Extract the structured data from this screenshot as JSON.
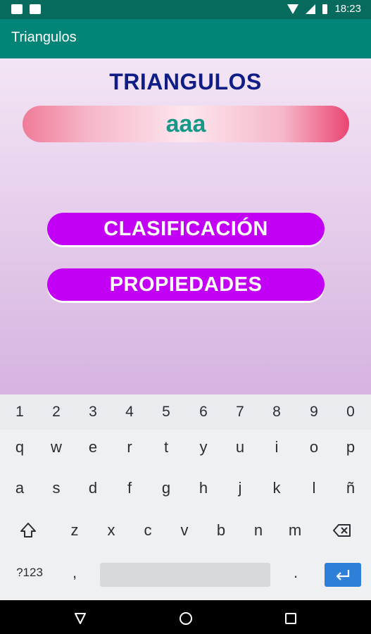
{
  "status_bar": {
    "time": "18:23"
  },
  "app_bar": {
    "title": "Triangulos"
  },
  "main": {
    "heading": "TRIANGULOS",
    "name_value": "aaa",
    "buttons": [
      {
        "label": "CLASIFICACIÓN"
      },
      {
        "label": "PROPIEDADES"
      }
    ]
  },
  "keyboard": {
    "number_row": [
      "1",
      "2",
      "3",
      "4",
      "5",
      "6",
      "7",
      "8",
      "9",
      "0"
    ],
    "row1": [
      "q",
      "w",
      "e",
      "r",
      "t",
      "y",
      "u",
      "i",
      "o",
      "p"
    ],
    "row2": [
      "a",
      "s",
      "d",
      "f",
      "g",
      "h",
      "j",
      "k",
      "l",
      "ñ"
    ],
    "row3": [
      "z",
      "x",
      "c",
      "v",
      "b",
      "n",
      "m"
    ],
    "symbols_label": "?123",
    "comma": ",",
    "period": "."
  }
}
